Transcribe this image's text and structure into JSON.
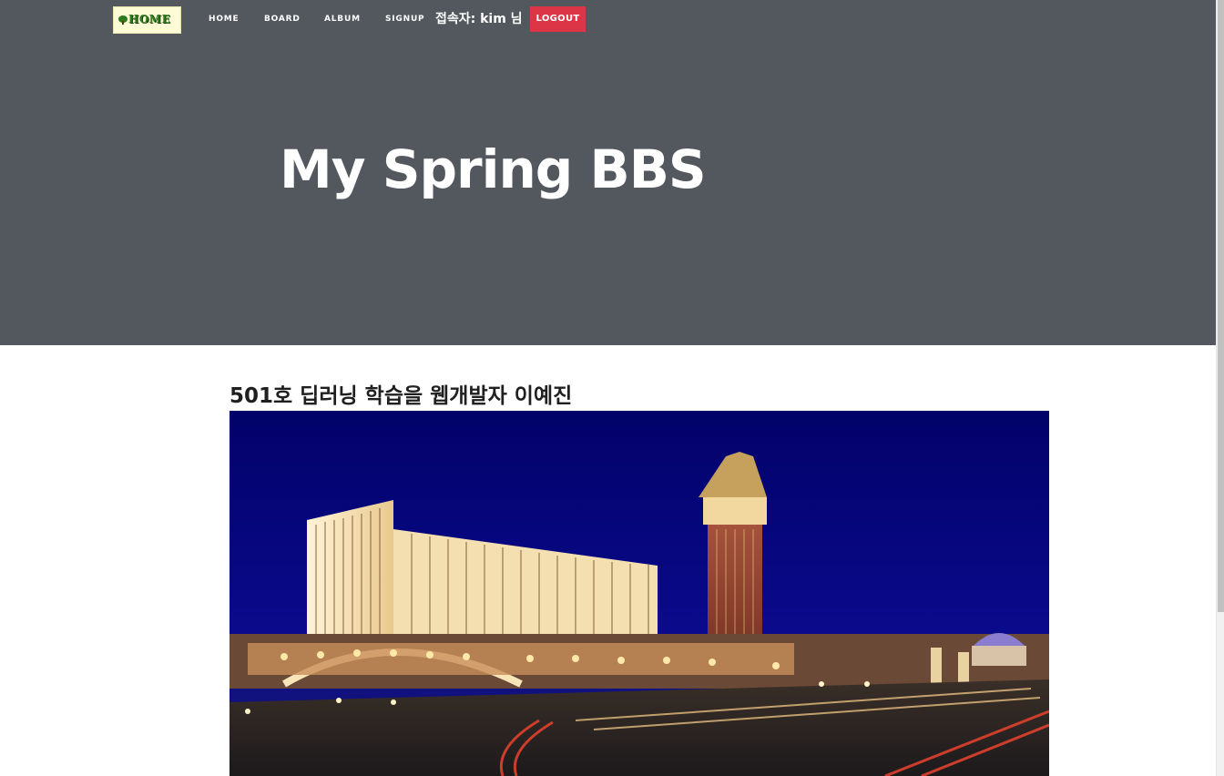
{
  "navbar": {
    "logo_text": "HOME",
    "links": [
      {
        "label": "HOME"
      },
      {
        "label": "BOARD"
      },
      {
        "label": "ALBUM"
      },
      {
        "label": "SIGNUP"
      }
    ],
    "user_greeting": "접속자: kim 님",
    "logout_label": "LOGOUT"
  },
  "hero": {
    "title": "My Spring BBS"
  },
  "post": {
    "title": "501호 딥러닝 학습을 웹개발자 이예진"
  },
  "colors": {
    "header_bg": "#53575e",
    "logout_bg": "#dc3545",
    "photo_sky": "#06057a"
  }
}
